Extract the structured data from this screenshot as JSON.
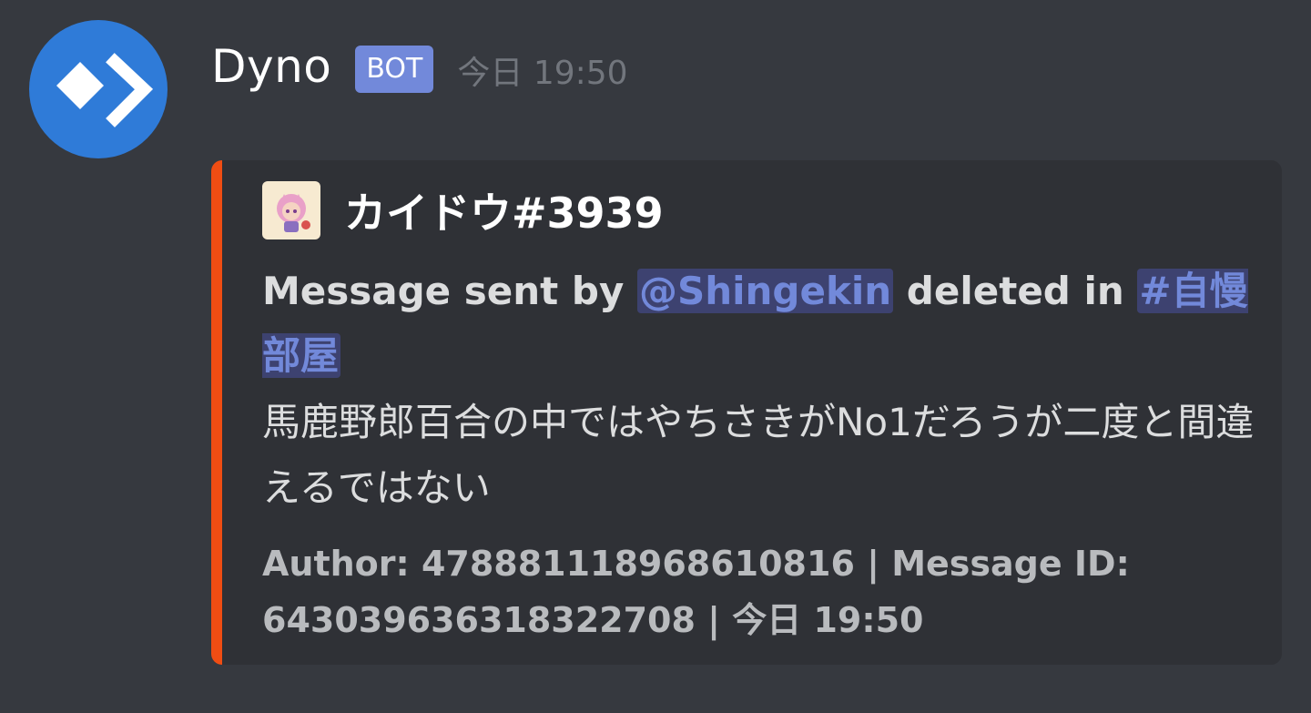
{
  "message": {
    "username": "Dyno",
    "bot_tag": "BOT",
    "timestamp": "今日 19:50",
    "avatar_icon": "dyno-logo-icon",
    "avatar_color": "#2f7bd8"
  },
  "embed": {
    "accent_color": "#f04d13",
    "author": {
      "name": "カイドウ#3939",
      "icon": "anime-avatar-icon"
    },
    "title": {
      "prefix": "Message sent by ",
      "user_mention": "@Shingekin",
      "middle": " deleted in ",
      "channel_mention": "#自慢部屋"
    },
    "content": "馬鹿野郎百合の中ではやちさきがNo1だろうが二度と間違えるではない",
    "footer": "Author: 478881118968610816 | Message ID: 643039636318322708 | 今日 19:50"
  }
}
